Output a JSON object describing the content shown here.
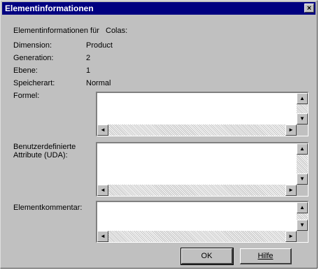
{
  "window": {
    "title": "Elementinformationen",
    "close_glyph": "×"
  },
  "header": {
    "label": "Elementinformationen für",
    "value": "Colas:"
  },
  "fields": [
    {
      "label": "Dimension:",
      "value": "Product"
    },
    {
      "label": "Generation:",
      "value": "2"
    },
    {
      "label": "Ebene:",
      "value": "1"
    },
    {
      "label": "Speicherart:",
      "value": "Normal"
    }
  ],
  "textareas": {
    "formula_label": "Formel:",
    "uda_label": "Benutzerdefinierte\nAttribute (UDA):",
    "comment_label": "Elementkommentar:"
  },
  "scroll_glyphs": {
    "up": "▲",
    "down": "▼",
    "left": "◄",
    "right": "►"
  },
  "buttons": {
    "ok": "OK",
    "help": "Hilfe"
  }
}
